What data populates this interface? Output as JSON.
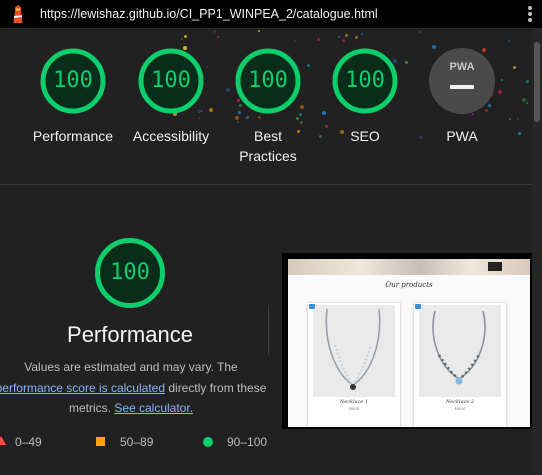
{
  "browser": {
    "url": "https://lewishaz.github.io/CI_PP1_WINPEA_2/catalogue.html",
    "logo_icon": "lighthouse-icon",
    "menu_icon": "kebab-menu-icon"
  },
  "scores": {
    "items": [
      {
        "score": "100",
        "label": "Performance"
      },
      {
        "score": "100",
        "label": "Accessibility"
      },
      {
        "score": "100",
        "label": "Best Practices"
      },
      {
        "score": "100",
        "label": "SEO"
      }
    ],
    "pwa": {
      "badge": "PWA",
      "label": "PWA"
    }
  },
  "performance": {
    "score": "100",
    "title": "Performance",
    "desc_line1": "Values are estimated and may vary. The",
    "desc_link1": "performance score is calculated",
    "desc_mid": " directly from these",
    "desc_line3": "metrics. ",
    "desc_link2": "See calculator."
  },
  "legend": {
    "fail": "0–49",
    "average": "50–89",
    "pass": "90–100"
  },
  "thumbnail": {
    "heading": "Our products",
    "cards": [
      {
        "name": "Necklace 1",
        "price": "£45.00"
      },
      {
        "name": "Necklace 2",
        "price": "£45.00"
      }
    ]
  },
  "colors": {
    "pass": "#0cce6b",
    "average": "#ffa400",
    "fail": "#ff4e42",
    "link": "#8ab4f8",
    "background": "#212121"
  }
}
